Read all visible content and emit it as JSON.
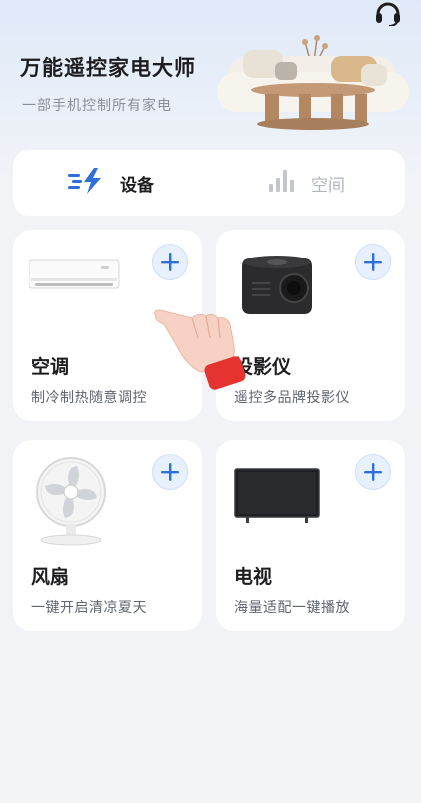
{
  "header": {
    "title": "万能遥控家电大师",
    "subtitle": "一部手机控制所有家电",
    "support_icon": "headset-icon"
  },
  "tabs": [
    {
      "label": "设备",
      "icon": "devices-bolt-icon",
      "active": true
    },
    {
      "label": "空间",
      "icon": "bar-chart-icon",
      "active": false
    }
  ],
  "devices": [
    {
      "name": "空调",
      "desc": "制冷制热随意调控",
      "icon": "air-conditioner"
    },
    {
      "name": "投影仪",
      "desc": "遥控多品牌投影仪",
      "icon": "projector"
    },
    {
      "name": "风扇",
      "desc": "一键开启清凉夏天",
      "icon": "fan"
    },
    {
      "name": "电视",
      "desc": "海量适配一键播放",
      "icon": "tv"
    }
  ],
  "colors": {
    "accent": "#2f6fd8",
    "background": "#f1f3f7",
    "card": "#ffffff"
  }
}
